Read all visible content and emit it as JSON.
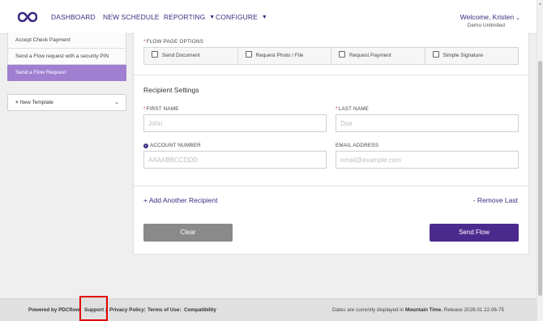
{
  "header": {
    "logo_icon": "infinity-logo-icon",
    "nav": [
      {
        "label": "DASHBOARD"
      },
      {
        "label": "NEW SCHEDULE"
      },
      {
        "label": "REPORTING"
      },
      {
        "label": "CONFIGURE"
      }
    ],
    "welcome": "Welcome, Kristen",
    "org": "Demo Unlimited"
  },
  "sidebar": {
    "items": [
      {
        "label": "Accept Check Payment"
      },
      {
        "label": "Send a Flow request with a security PIN"
      },
      {
        "label": "Send a Flow Request",
        "active": true
      }
    ],
    "new_template": "New Template"
  },
  "form": {
    "flow_page_options_label": "FLOW PAGE OPTIONS",
    "options": [
      {
        "label": "Send Document",
        "checked": false
      },
      {
        "label": "Request Photo / File",
        "checked": false
      },
      {
        "label": "Request Payment",
        "checked": false
      },
      {
        "label": "Simple Signature",
        "checked": false
      }
    ],
    "recipient_title": "Recipient Settings",
    "first_name_label": "FIRST NAME",
    "first_name_placeholder": "John",
    "last_name_label": "LAST NAME",
    "last_name_placeholder": "Doe",
    "account_number_label": "ACCOUNT NUMBER",
    "account_number_placeholder": "AAAABBCCDDD",
    "email_label": "EMAIL ADDRESS",
    "email_placeholder": "email@example.com",
    "add_recipient": "+ Add Another Recipient",
    "remove_last": "- Remove Last",
    "clear_button": "Clear",
    "send_button": "Send Flow"
  },
  "footer": {
    "powered_by": "Powered by PDCflow",
    "support": "Support",
    "privacy": "Privacy Policy",
    "terms": "Terms of Use",
    "compatibility": "Compatibility",
    "dates_prefix": "Dates are currently displayed in",
    "timezone": "Mountain Time.",
    "release": "Release 2026.01.22.06-75"
  },
  "colors": {
    "brand": "#3d2a80",
    "active_sidebar": "#a07fd1",
    "send_button": "#4b2a8e",
    "clear_button": "#8a8a8a",
    "highlight": "#e00000"
  }
}
